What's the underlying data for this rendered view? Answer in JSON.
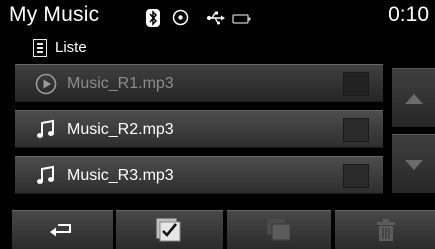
{
  "status_bar": {
    "title": "My Music",
    "time": "0:10",
    "icons": [
      "bluetooth-icon",
      "disc-icon",
      "usb-icon",
      "battery-icon"
    ]
  },
  "subheader": {
    "icon": "list-icon",
    "label": "Liste"
  },
  "list": {
    "items": [
      {
        "label": "Music_R1.mp3",
        "icon": "play-circle-icon",
        "state": "playing"
      },
      {
        "label": "Music_R2.mp3",
        "icon": "music-note-icon",
        "state": "normal"
      },
      {
        "label": "Music_R3.mp3",
        "icon": "music-note-icon",
        "state": "normal"
      }
    ]
  },
  "scroll": {
    "up_icon": "arrow-up-icon",
    "down_icon": "arrow-down-icon"
  },
  "toolbar": {
    "buttons": [
      {
        "name": "back-button",
        "icon": "return-arrow-icon",
        "enabled": true
      },
      {
        "name": "select-all-button",
        "icon": "checkbox-icon",
        "enabled": true
      },
      {
        "name": "copy-button",
        "icon": "copy-icon",
        "enabled": false
      },
      {
        "name": "delete-button",
        "icon": "trash-icon",
        "enabled": false
      }
    ]
  },
  "colors": {
    "background": "#000000",
    "text": "#ffffff",
    "dim_text": "#8c8c8c",
    "row_top": "#4d4d4d",
    "row_bottom": "#2e2e2e"
  }
}
